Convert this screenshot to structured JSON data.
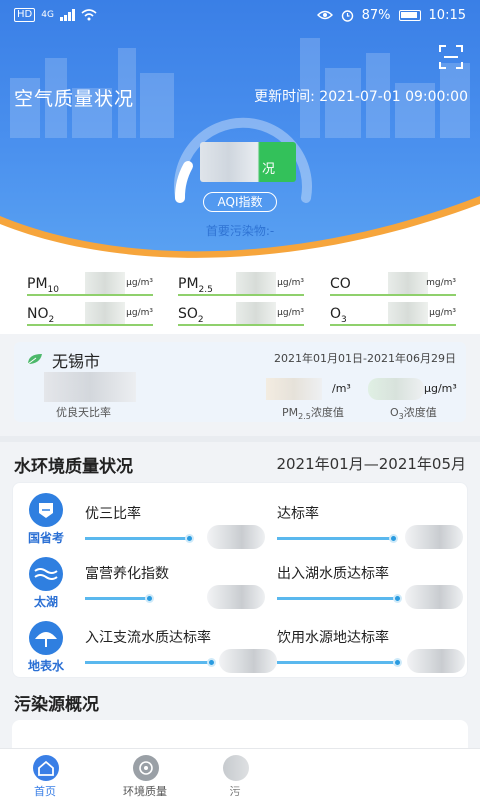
{
  "status_bar": {
    "sim_label": "HD",
    "network_label": "4G",
    "battery_percent": "87%",
    "time": "10:15"
  },
  "air": {
    "title": "空气质量状况",
    "update_label": "更新时间: 2021-07-01 09:00:00",
    "gauge_suffix": "况",
    "aqi_button": "AQI指数",
    "primary_pollutant": "首要污染物:-",
    "pollutants": [
      {
        "name": "PM",
        "sub": "10",
        "unit": "μg/m³"
      },
      {
        "name": "PM",
        "sub": "2.5",
        "unit": "μg/m³"
      },
      {
        "name": "CO",
        "sub": "",
        "unit": "mg/m³"
      },
      {
        "name": "NO",
        "sub": "2",
        "unit": "μg/m³"
      },
      {
        "name": "SO",
        "sub": "2",
        "unit": "μg/m³"
      },
      {
        "name": "O",
        "sub": "3",
        "unit": "μg/m³"
      }
    ]
  },
  "city": {
    "name": "无锡市",
    "date_range": "2021年01月01日-2021年06月29日",
    "rate_label": "优良天比率",
    "pm25_unit": "/m³",
    "pm25_label_pre": "PM",
    "pm25_label_sub": "2.5",
    "pm25_label_post": "浓度值",
    "o3_unit": "μg/m³",
    "o3_label_pre": "O",
    "o3_label_sub": "3",
    "o3_label_post": "浓度值"
  },
  "water": {
    "title": "水环境质量状况",
    "date_range": "2021年01月—2021年05月",
    "rows": [
      {
        "badge": "国省考",
        "left_metric": "优三比率",
        "right_metric": "达标率"
      },
      {
        "badge": "太湖",
        "left_metric": "富营养化指数",
        "right_metric": "出入湖水质达标率"
      },
      {
        "badge": "地表水",
        "left_metric": "入江支流水质达标率",
        "right_metric": "饮用水源地达标率"
      }
    ]
  },
  "pollution_source": {
    "title": "污染源概况"
  },
  "tabs": [
    {
      "label": "首页",
      "active": true
    },
    {
      "label": "环境质量",
      "active": false
    },
    {
      "label": "污",
      "active": false
    }
  ],
  "colors": {
    "primary_blue": "#3a7fe6",
    "accent_green": "#33c15a",
    "track_blue": "#5ab8ee"
  }
}
